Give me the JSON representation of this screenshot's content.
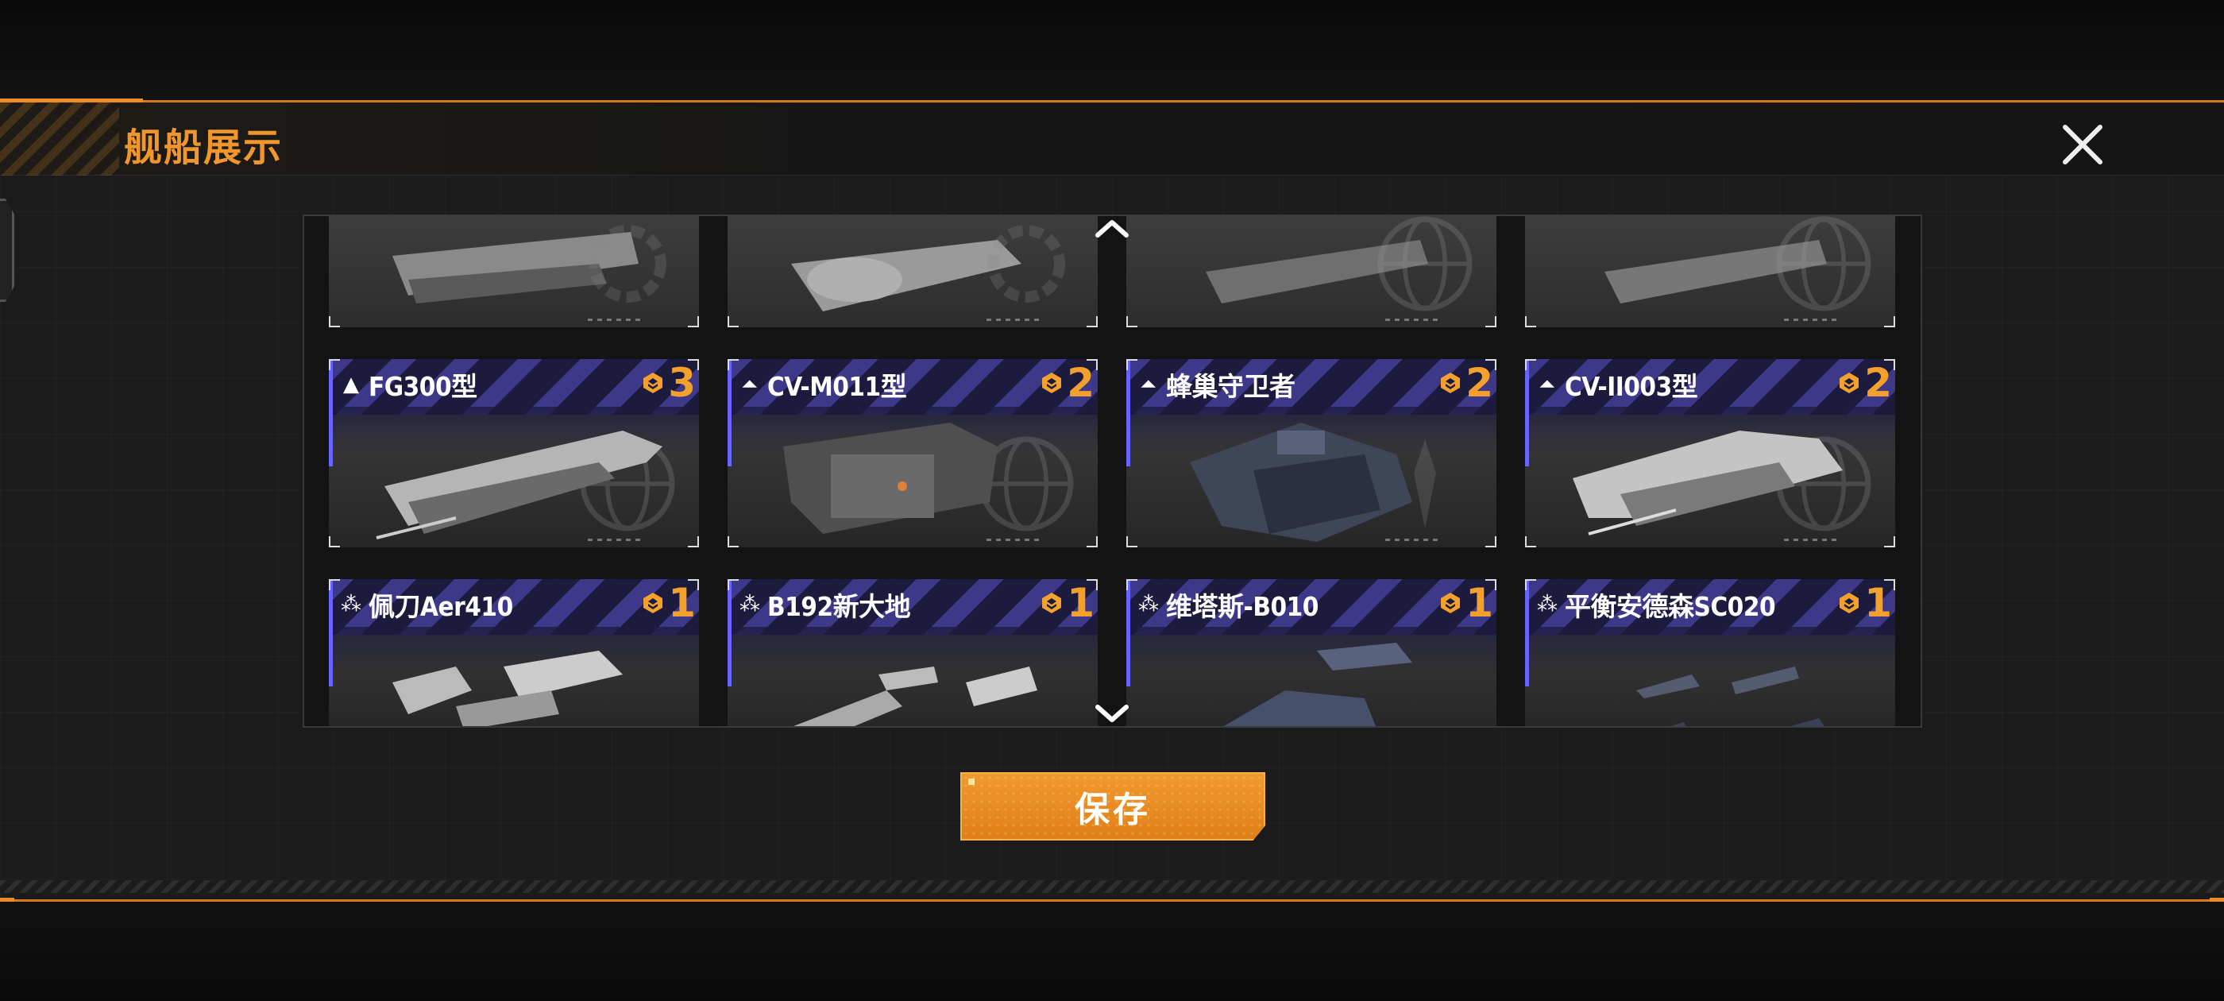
{
  "header": {
    "title": "舰船展示"
  },
  "buttons": {
    "save_label": "保存"
  },
  "icons": {
    "close": "close-icon",
    "scroll_up": "chevron-up-icon",
    "scroll_down": "chevron-down-icon",
    "cost": "hexagon-token-icon"
  },
  "colors": {
    "accent": "#f0962c",
    "cost_text": "#f3a02d",
    "card_top": "#1c1b3d",
    "card_bar": "#6a64ff"
  },
  "ships": {
    "partial_row": [
      {
        "name": ""
      },
      {
        "name": ""
      },
      {
        "name": ""
      },
      {
        "name": ""
      }
    ],
    "row1": [
      {
        "name": "FG300型",
        "class_icon": "▲",
        "cost": "3"
      },
      {
        "name": "CV-M011型",
        "class_icon": "⏶",
        "cost": "2"
      },
      {
        "name": "蜂巢守卫者",
        "class_icon": "⏶",
        "cost": "2"
      },
      {
        "name": "CV-II003型",
        "class_icon": "⏶",
        "cost": "2"
      }
    ],
    "row2": [
      {
        "name": "佩刀Aer410",
        "class_icon": "⁂",
        "cost": "1"
      },
      {
        "name": "B192新大地",
        "class_icon": "⁂",
        "cost": "1"
      },
      {
        "name": "维塔斯-B010",
        "class_icon": "⁂",
        "cost": "1"
      },
      {
        "name": "平衡安德森SC020",
        "class_icon": "⁂",
        "cost": "1"
      }
    ]
  }
}
